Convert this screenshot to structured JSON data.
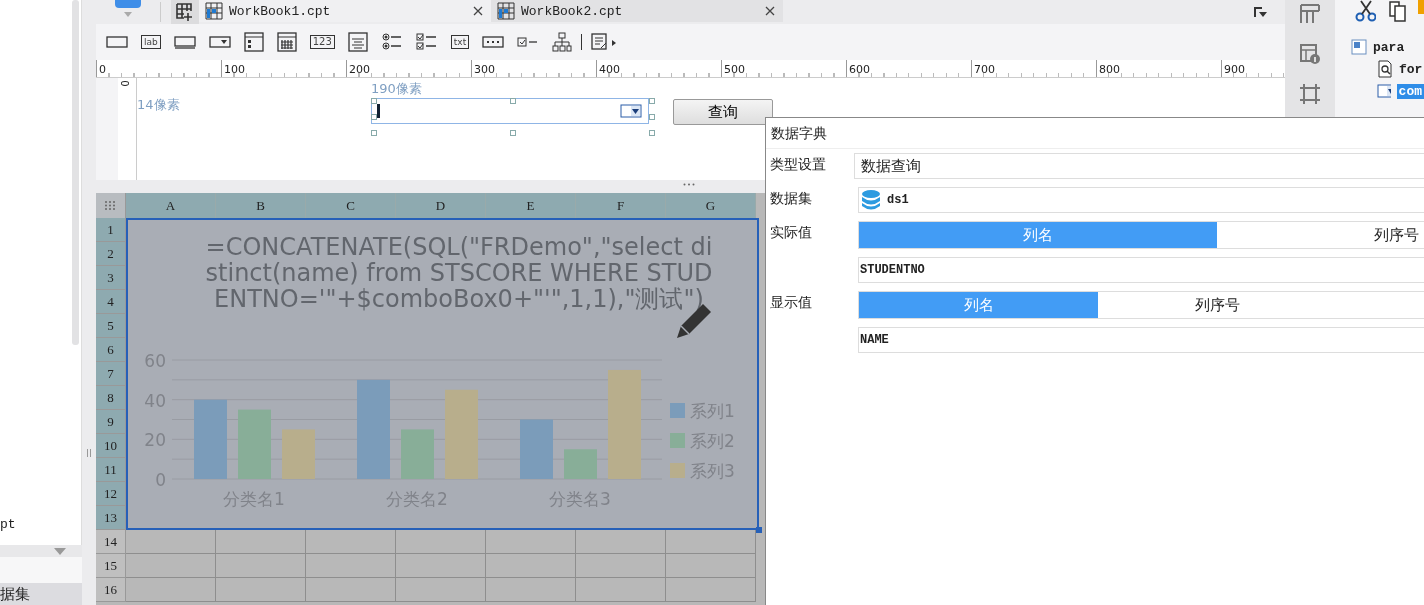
{
  "left_panel": {
    "file_item": "pt",
    "section_tab": "据集"
  },
  "tabs": [
    {
      "label": "WorkBook1.cpt",
      "selected": true
    },
    {
      "label": "WorkBook2.cpt",
      "selected": false
    }
  ],
  "toolbar": [
    {
      "kind": "button"
    },
    {
      "kind": "label",
      "label": "lab"
    },
    {
      "kind": "textarea"
    },
    {
      "kind": "combo"
    },
    {
      "kind": "list"
    },
    {
      "kind": "date"
    },
    {
      "kind": "number",
      "label": "123"
    },
    {
      "kind": "text"
    },
    {
      "kind": "radio"
    },
    {
      "kind": "checkgroup"
    },
    {
      "kind": "label",
      "label": "txt"
    },
    {
      "kind": "password"
    },
    {
      "kind": "checkbox"
    },
    {
      "kind": "tree"
    },
    {
      "kind": "more"
    }
  ],
  "ruler": {
    "h_ticks": [
      "0",
      "100",
      "200",
      "300",
      "400",
      "500",
      "600",
      "700",
      "800",
      "900"
    ],
    "v_ticks": [
      "0"
    ]
  },
  "parameter_pane": {
    "left_label": "14像素",
    "width_label": "190像素",
    "query_button": "查询"
  },
  "sheet": {
    "columns": [
      {
        "label": "A",
        "selected": true
      },
      {
        "label": "B",
        "selected": true
      },
      {
        "label": "C",
        "selected": true
      },
      {
        "label": "D",
        "selected": true
      },
      {
        "label": "E",
        "selected": true
      },
      {
        "label": "F",
        "selected": true
      },
      {
        "label": "G",
        "selected": true
      }
    ],
    "rows": [
      {
        "label": "1",
        "selected": true
      },
      {
        "label": "2",
        "selected": true
      },
      {
        "label": "3",
        "selected": true
      },
      {
        "label": "4",
        "selected": true
      },
      {
        "label": "5",
        "selected": true
      },
      {
        "label": "6",
        "selected": true
      },
      {
        "label": "7",
        "selected": true
      },
      {
        "label": "8",
        "selected": true
      },
      {
        "label": "9",
        "selected": true
      },
      {
        "label": "10",
        "selected": true
      },
      {
        "label": "11",
        "selected": true
      },
      {
        "label": "12",
        "selected": true
      },
      {
        "label": "13",
        "selected": true
      },
      {
        "label": "14",
        "selected": false
      },
      {
        "label": "15",
        "selected": false
      },
      {
        "label": "16",
        "selected": false
      }
    ],
    "chart_data": {
      "type": "bar",
      "title": "=CONCATENATE(SQL(\"FRDemo\",\"select distinct(name) from STSCORE WHERE STUDENTNO='\"+$comboBox0+\"'\",1,1),\"测试\")",
      "categories": [
        "分类名1",
        "分类名2",
        "分类名3"
      ],
      "ylim": [
        0,
        60
      ],
      "legend": true,
      "yticks": [
        0,
        20,
        40,
        60
      ],
      "series": [
        {
          "name": "系列1",
          "color": "#7b9cba",
          "values": [
            40,
            50,
            30
          ]
        },
        {
          "name": "系列2",
          "color": "#88ae98",
          "values": [
            35,
            25,
            15
          ]
        },
        {
          "name": "系列3",
          "color": "#b8ae8c",
          "values": [
            25,
            45,
            55
          ]
        }
      ]
    }
  },
  "dialog": {
    "title": "数据字典",
    "rows": [
      {
        "kind": "select",
        "label": "类型设置",
        "value": "数据查询"
      },
      {
        "kind": "dataset",
        "label": "数据集",
        "value": "ds1"
      },
      {
        "kind": "column",
        "label": "实际值",
        "options": [
          {
            "label": "列名",
            "selected": true
          },
          {
            "label": "列序号",
            "selected": false
          }
        ],
        "value": "STUDENTNO"
      },
      {
        "kind": "column",
        "label": "显示值",
        "options": [
          {
            "label": "列名",
            "selected": true
          },
          {
            "label": "列序号",
            "selected": false
          }
        ],
        "value": "NAME"
      }
    ]
  },
  "tree": [
    {
      "label": "para",
      "kind": "para",
      "selected": false,
      "children": [
        {
          "label": "for",
          "kind": "form",
          "selected": false
        },
        {
          "label": "com",
          "kind": "combo",
          "selected": true
        }
      ]
    }
  ]
}
